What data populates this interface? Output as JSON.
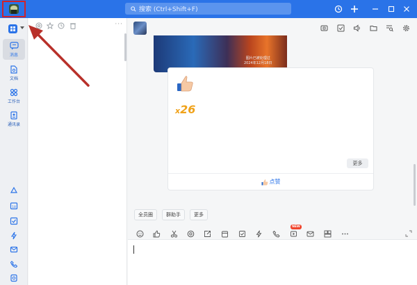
{
  "titlebar": {
    "search_placeholder": "搜索 (Ctrl+Shift+F)",
    "icons": [
      "history-icon",
      "add-icon",
      "minimize-icon",
      "maximize-icon",
      "close-icon"
    ],
    "accent": "#2a73e8"
  },
  "nav": {
    "items": [
      {
        "label": "消息",
        "icon": "message-icon"
      },
      {
        "label": "文档",
        "icon": "document-icon"
      },
      {
        "label": "工作台",
        "icon": "workbench-icon"
      },
      {
        "label": "通讯录",
        "icon": "contacts-icon"
      }
    ],
    "bottom_icons": [
      "cloud-icon",
      "calendar-icon",
      "todo-icon",
      "lightning-icon",
      "mail-icon",
      "phone-icon",
      "doc-share-icon"
    ]
  },
  "list": {
    "toolbar_icons": [
      "at-icon",
      "star-icon",
      "clock-icon",
      "trash-icon"
    ],
    "more": "···"
  },
  "chat": {
    "header_icons": [
      "screen-icon",
      "check-icon",
      "speaker-icon",
      "folder-icon",
      "search-record-icon",
      "settings-icon"
    ],
    "image_caption": "图片已被处理过\n2024年12月18日",
    "like_count_prefix": "x",
    "like_count": "26",
    "more_label": "更多",
    "like_action": "点赞",
    "quick_buttons": [
      "全员圈",
      "群助手",
      "更多"
    ],
    "toolbar_icons": [
      "emoji-icon",
      "thumbs-up-icon",
      "scissors-icon",
      "at-icon",
      "share-icon",
      "calendar-icon",
      "task-icon",
      "lightning-icon",
      "phone-icon",
      "video-icon",
      "mail-icon",
      "layout-icon",
      "more-icon"
    ],
    "new_badge": "NEW"
  },
  "colors": {
    "annotation": "#c0312c",
    "like_count": "#f0a21a"
  }
}
